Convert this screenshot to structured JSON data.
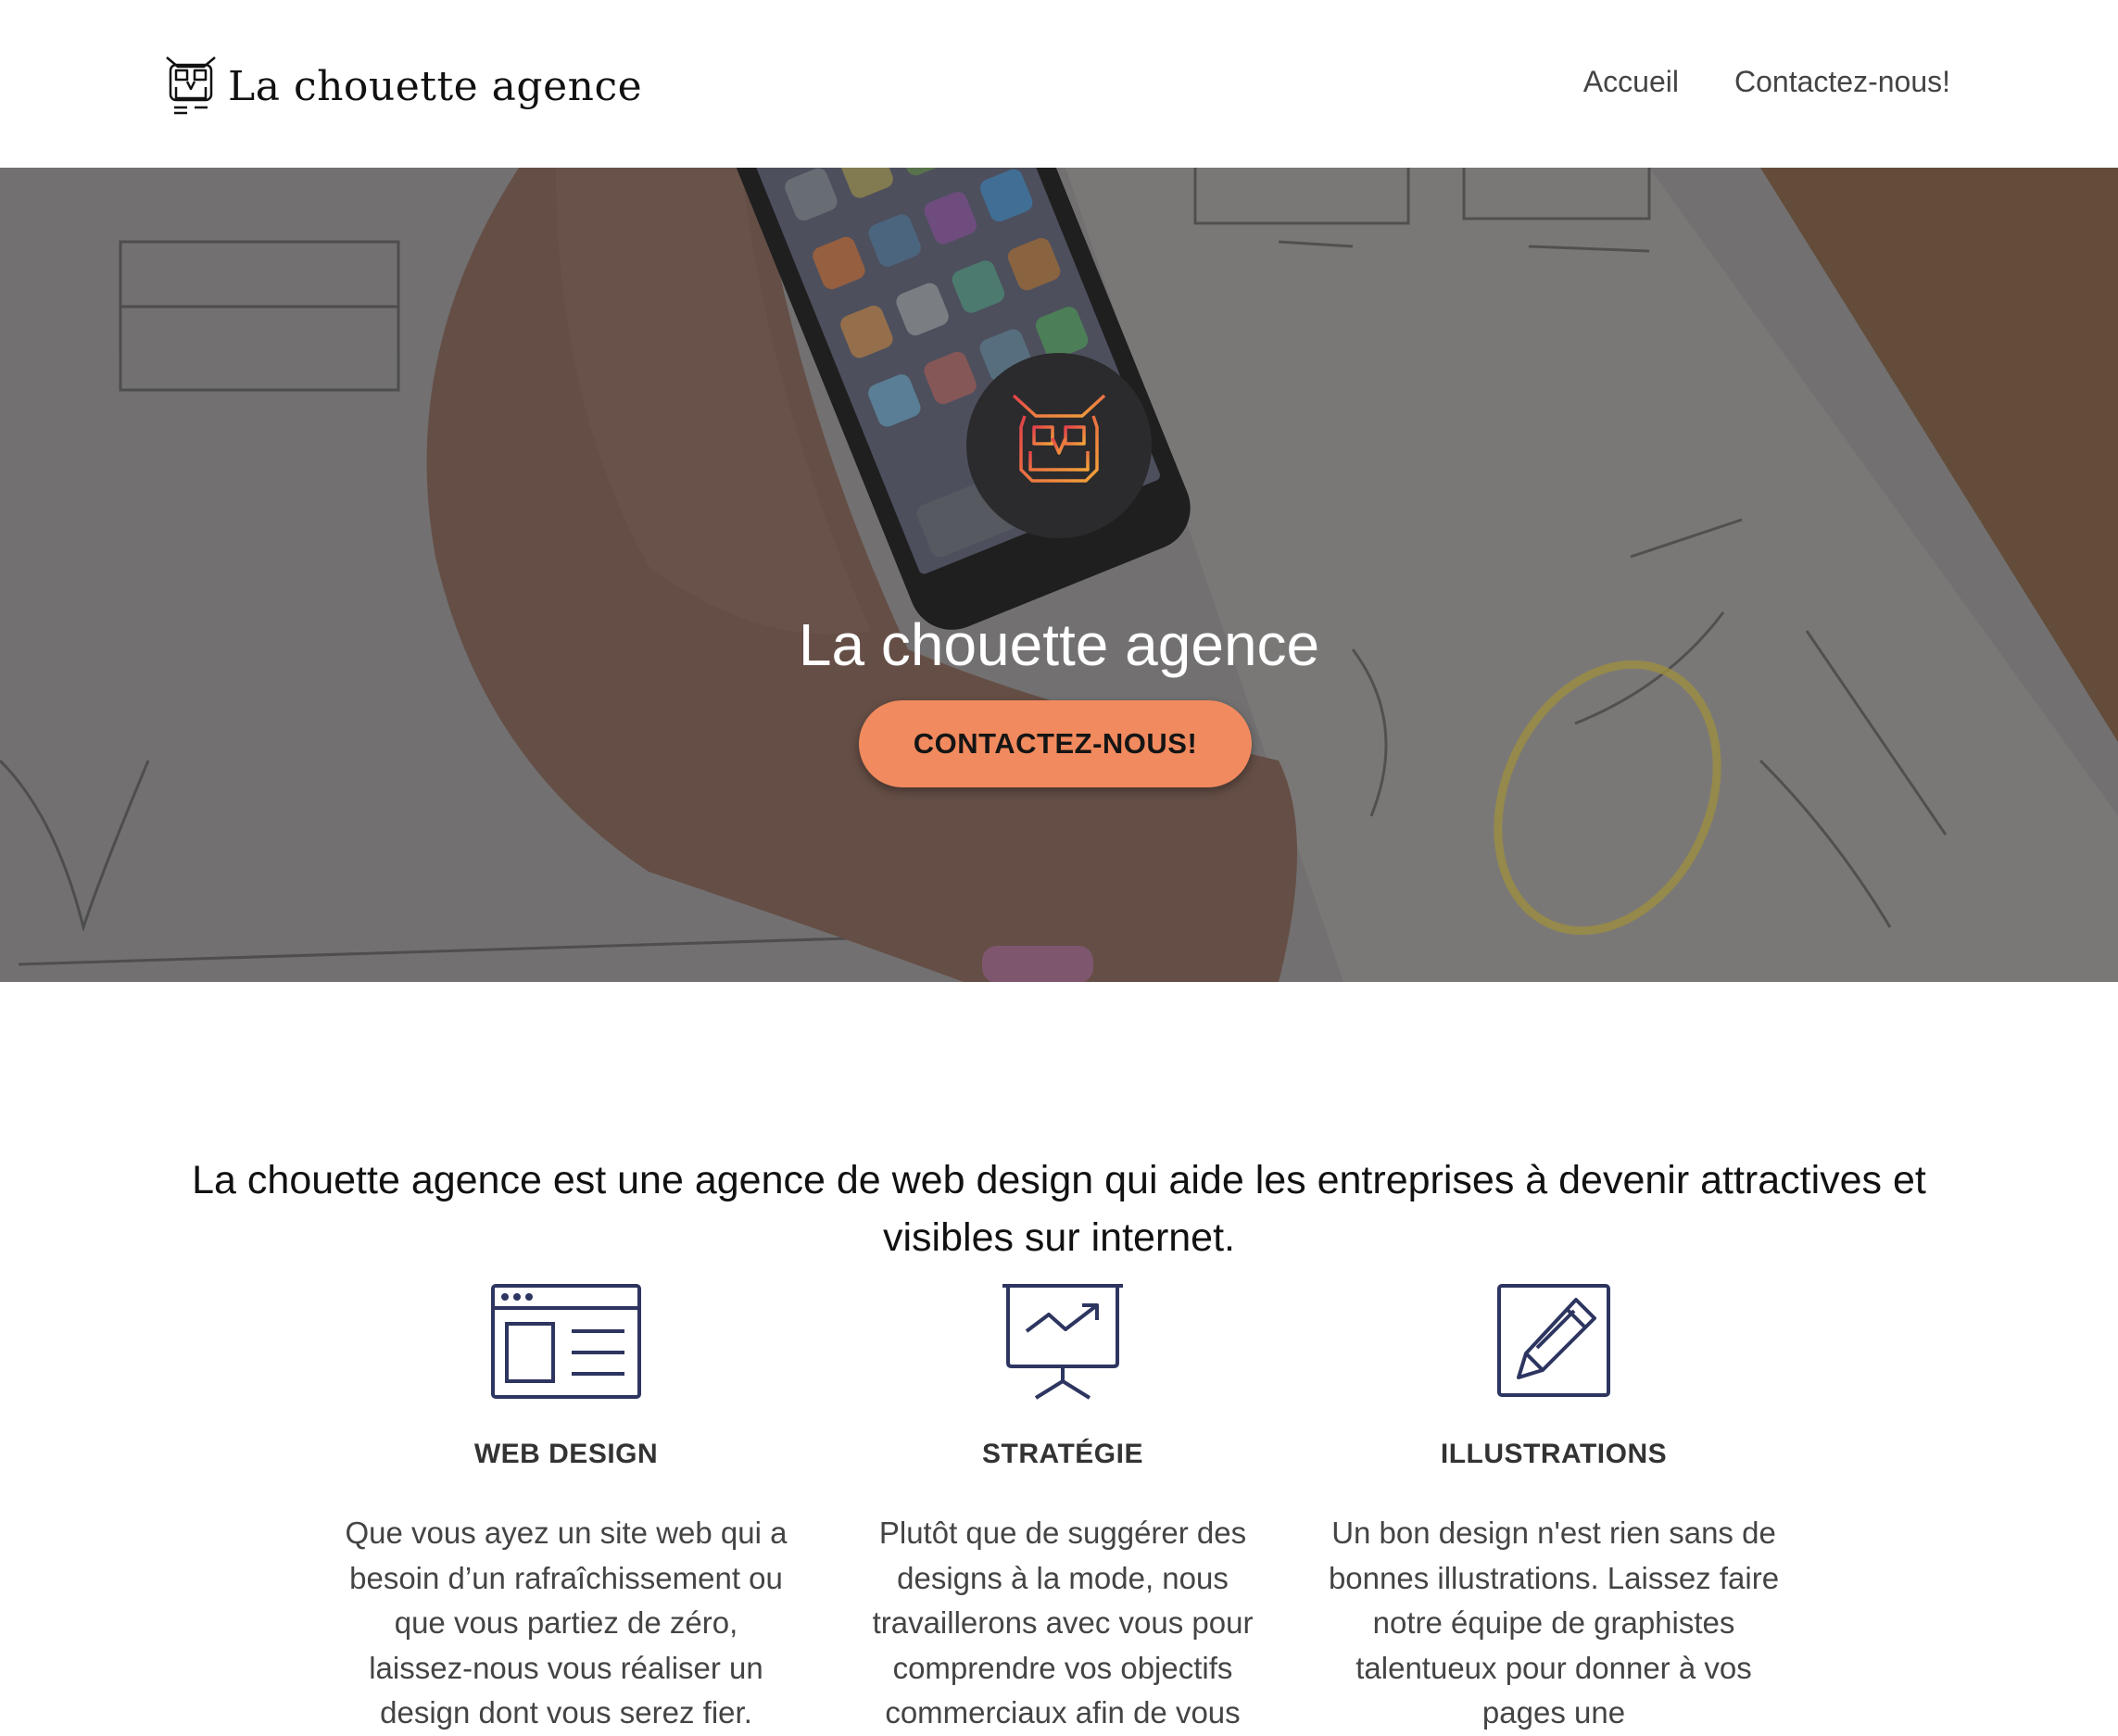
{
  "header": {
    "brand_name": "La chouette agence",
    "brand_logo_icon": "owl-logo-icon",
    "nav": [
      {
        "label": "Accueil"
      },
      {
        "label": "Contactez-nous!"
      }
    ]
  },
  "hero": {
    "badge_icon": "owl-gradient-icon",
    "title": "La chouette agence",
    "cta_label": "CONTACTEZ-NOUS!"
  },
  "intro": {
    "text": "La chouette agence est une agence de web design qui aide les entreprises à devenir attractives et visibles sur internet."
  },
  "services": [
    {
      "icon": "web-design-icon",
      "title": "WEB DESIGN",
      "text": "Que vous ayez un site web qui a besoin d’un rafraîchissement ou que vous partiez de zéro, laissez-nous vous réaliser un design dont vous serez fier."
    },
    {
      "icon": "presentation-chart-icon",
      "title": "STRATÉGIE",
      "text": "Plutôt que de suggérer des designs à la mode, nous travaillerons avec vous pour comprendre vos objectifs commerciaux afin de vous"
    },
    {
      "icon": "pencil-edit-icon",
      "title": "ILLUSTRATIONS",
      "text": "Un bon design n'est rien sans de bonnes illustrations. Laissez faire notre équipe de graphistes talentueux pour donner à vos pages une"
    }
  ],
  "colors": {
    "accent": "#f18a5e",
    "icon_navy": "#2d3560",
    "badge_bg": "#2b2b2d"
  }
}
